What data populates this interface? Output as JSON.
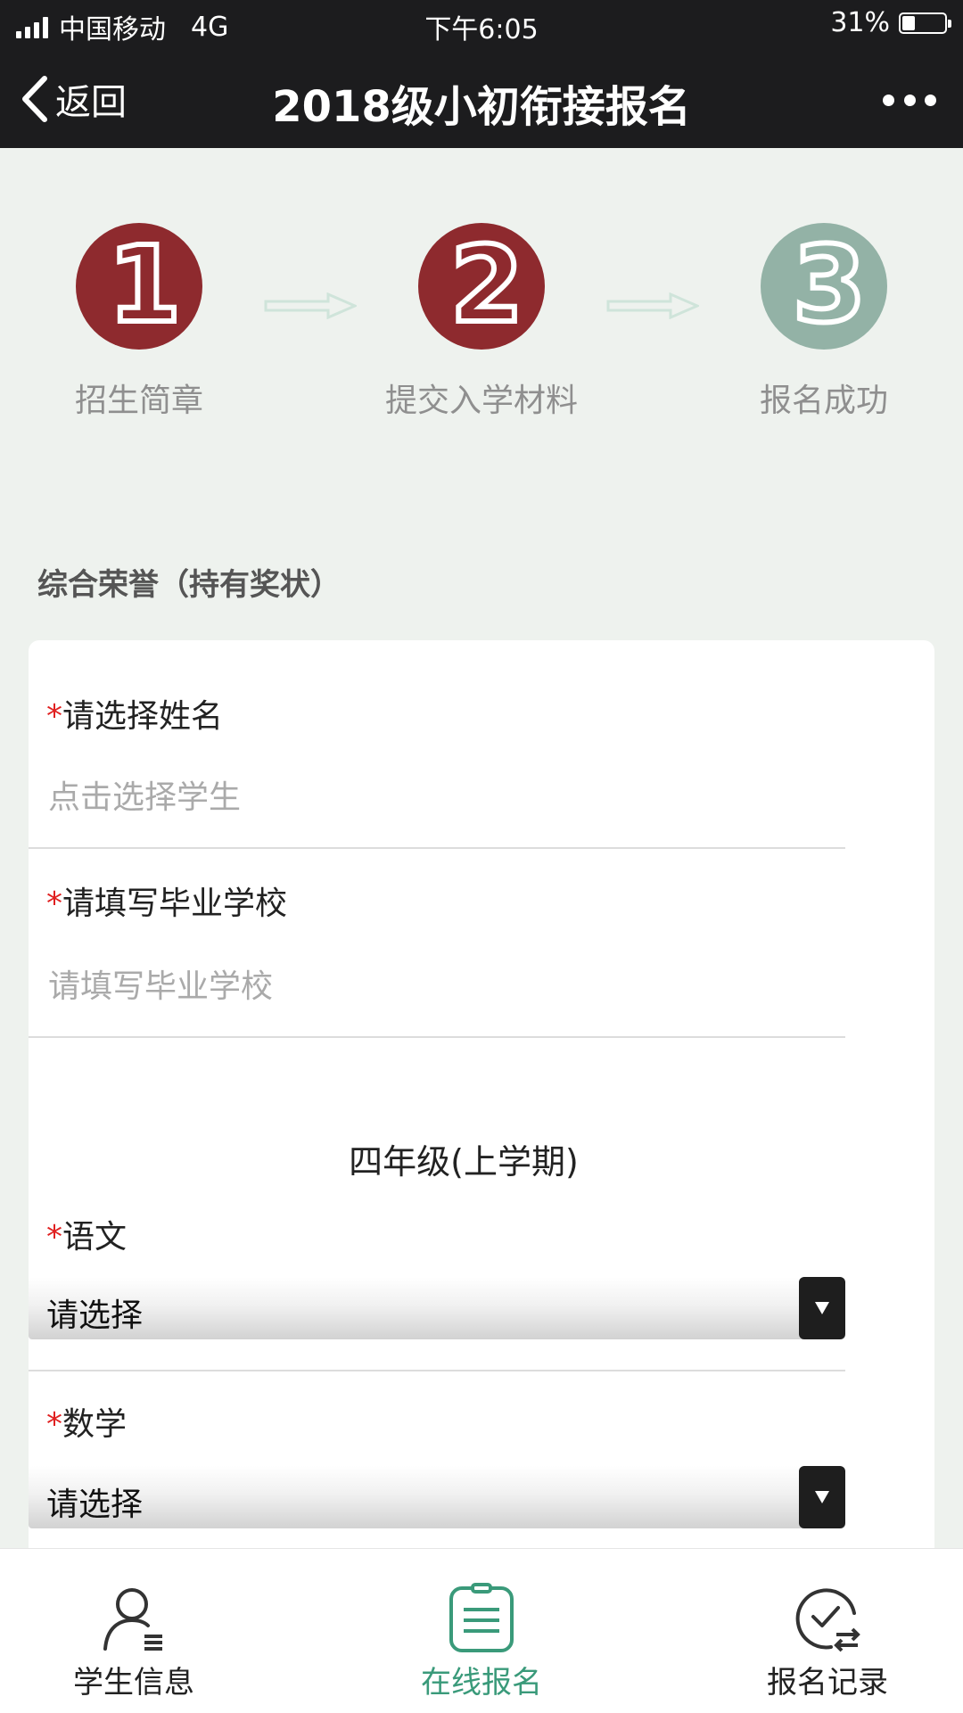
{
  "status_bar": {
    "carrier": "中国移动",
    "network": "4G",
    "time": "下午6:05",
    "battery_text": "31%",
    "battery_level": 0.31
  },
  "nav": {
    "back_label": "返回",
    "title": "2018级小初衔接报名",
    "more_icon": "more-dots-icon"
  },
  "steps": [
    {
      "number": "1",
      "label": "招生简章",
      "state": "active"
    },
    {
      "number": "2",
      "label": "提交入学材料",
      "state": "active"
    },
    {
      "number": "3",
      "label": "报名成功",
      "state": "inactive"
    }
  ],
  "colors": {
    "step_active": "#8e2a2e",
    "step_inactive": "#93b2a6",
    "arrow": "#cfe4da",
    "accent_green": "#3a9a7a",
    "required": "#e02020"
  },
  "section_title": "综合荣誉（持有奖状）",
  "form": {
    "required_mark": "*",
    "name_field": {
      "label": "请选择姓名",
      "placeholder": "点击选择学生",
      "value": ""
    },
    "school_field": {
      "label": "请填写毕业学校",
      "placeholder": "请填写毕业学校",
      "value": ""
    },
    "semester_title": "四年级(上学期)",
    "subjects": [
      {
        "label": "语文",
        "selected": "请选择"
      },
      {
        "label": "数学",
        "selected": "请选择"
      }
    ]
  },
  "tab_bar": {
    "items": [
      {
        "label": "学生信息",
        "icon": "user-list-icon",
        "active": false
      },
      {
        "label": "在线报名",
        "icon": "clipboard-icon",
        "active": true
      },
      {
        "label": "报名记录",
        "icon": "check-history-icon",
        "active": false
      }
    ]
  }
}
